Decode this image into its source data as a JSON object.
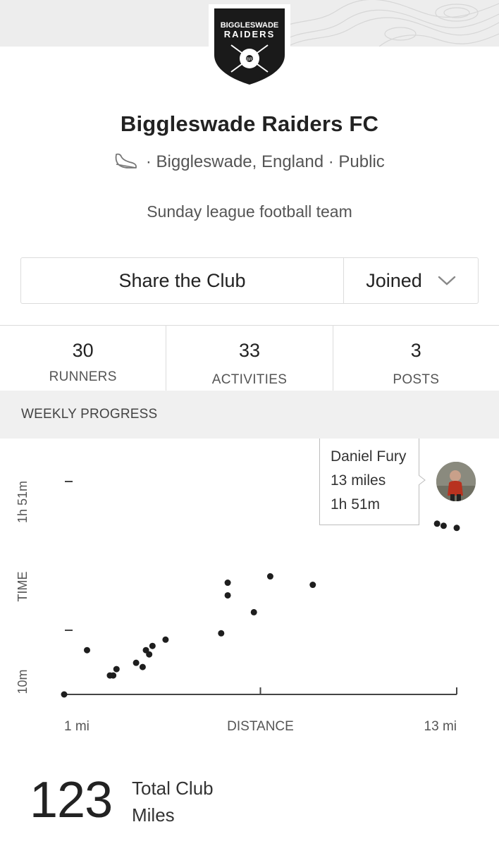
{
  "club": {
    "name": "Biggleswade Raiders FC",
    "location": "Biggleswade, England",
    "visibility": "Public",
    "separator": "·",
    "description": "Sunday league football team",
    "badge_line1": "BIGGLESWADE",
    "badge_line2": "RAIDERS",
    "badge_initials": "BR"
  },
  "actions": {
    "share_label": "Share the Club",
    "joined_label": "Joined"
  },
  "stats": [
    {
      "value": "30",
      "label": "RUNNERS"
    },
    {
      "value": "33",
      "label": "ACTIVITIES"
    },
    {
      "value": "3",
      "label": "POSTS"
    }
  ],
  "weekly_progress": {
    "section_title": "WEEKLY PROGRESS",
    "tooltip": {
      "name": "Daniel Fury",
      "distance": "13 miles",
      "time": "1h 51m"
    }
  },
  "chart_data": {
    "type": "scatter",
    "xlabel": "DISTANCE",
    "ylabel": "TIME",
    "x_tick_labels": [
      "1 mi",
      "13 mi"
    ],
    "y_tick_labels": [
      "10m",
      "1h 51m"
    ],
    "xlim": [
      1,
      13
    ],
    "ylim_minutes": [
      10,
      111
    ],
    "points": [
      {
        "x": 1.0,
        "y": 10
      },
      {
        "x": 1.7,
        "y": 31
      },
      {
        "x": 2.4,
        "y": 19
      },
      {
        "x": 2.5,
        "y": 19
      },
      {
        "x": 2.6,
        "y": 22
      },
      {
        "x": 3.2,
        "y": 25
      },
      {
        "x": 3.4,
        "y": 23
      },
      {
        "x": 3.5,
        "y": 31
      },
      {
        "x": 3.6,
        "y": 29
      },
      {
        "x": 3.7,
        "y": 33
      },
      {
        "x": 4.1,
        "y": 36
      },
      {
        "x": 5.8,
        "y": 39
      },
      {
        "x": 6.0,
        "y": 57
      },
      {
        "x": 6.0,
        "y": 63
      },
      {
        "x": 6.8,
        "y": 49
      },
      {
        "x": 7.3,
        "y": 66
      },
      {
        "x": 8.6,
        "y": 62
      },
      {
        "x": 12.4,
        "y": 91
      },
      {
        "x": 12.6,
        "y": 90
      },
      {
        "x": 13.0,
        "y": 89
      }
    ]
  },
  "totals": {
    "value": "123",
    "label_line1": "Total Club",
    "label_line2": "Miles"
  },
  "colors": {
    "banner": "#ededed",
    "badge_shield": "#1a1a1a",
    "text_dark": "#222222",
    "text_muted": "#555555",
    "border": "#dcdcdc",
    "section_bg": "#f0f0f0"
  },
  "icons": {
    "shoe": "shoe-icon",
    "dropdown": "chevron-down-icon"
  }
}
